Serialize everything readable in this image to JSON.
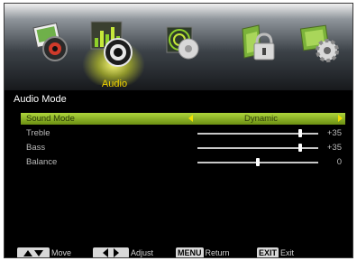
{
  "tabs": [
    {
      "name": "picture",
      "icon": "photo-camera-icon",
      "active": false
    },
    {
      "name": "audio",
      "icon": "audio-equalizer-speaker-icon",
      "active": true,
      "label": "Audio"
    },
    {
      "name": "timer",
      "icon": "clock-disc-icon",
      "active": false
    },
    {
      "name": "lock",
      "icon": "padlock-icon",
      "active": false
    },
    {
      "name": "setup",
      "icon": "gear-icon",
      "active": false
    }
  ],
  "section_title": "Audio Mode",
  "settings": {
    "sound_mode": {
      "label": "Sound Mode",
      "value": "Dynamic"
    },
    "treble": {
      "label": "Treble",
      "value": "+35",
      "level": 0.85
    },
    "bass": {
      "label": "Bass",
      "value": "+35",
      "level": 0.85
    },
    "balance": {
      "label": "Balance",
      "value": "0",
      "level": 0.5
    }
  },
  "footer": {
    "move": "Move",
    "adjust": "Adjust",
    "menu_key": "MENU",
    "return": "Return",
    "exit_key": "EXIT",
    "exit": "Exit"
  },
  "colors": {
    "active_label": "#f2d400",
    "highlight": "#9fc930",
    "arrow": "#f2e000"
  }
}
